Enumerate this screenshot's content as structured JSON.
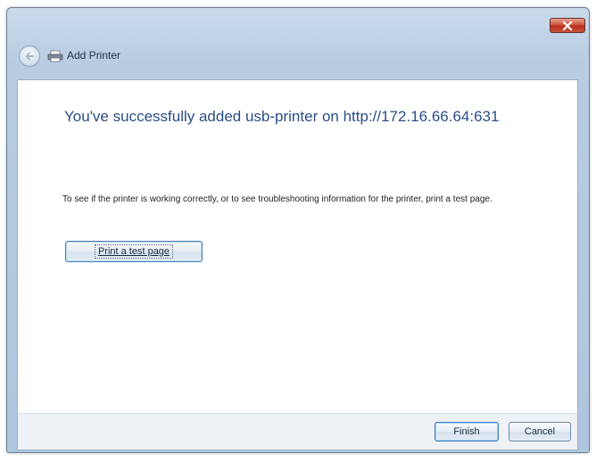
{
  "window": {
    "title": "Add Printer"
  },
  "icons": {
    "close": "close-icon",
    "back": "back-arrow-icon",
    "wizard": "printer-icon"
  },
  "main": {
    "heading": "You've successfully added usb-printer on http://172.16.66.64:631",
    "instruction": "To see if the printer is working correctly, or to see troubleshooting information for the printer, print a test page.",
    "test_page_button": "Print a test page"
  },
  "footer": {
    "finish_label": "Finish",
    "cancel_label": "Cancel"
  },
  "colors": {
    "heading": "#2b4d88",
    "close_button": "#c8533a",
    "frame": "#b8cde2"
  }
}
